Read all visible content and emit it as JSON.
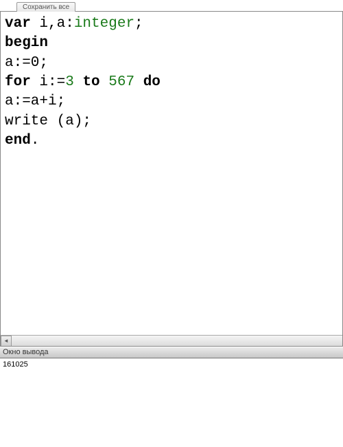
{
  "tab": {
    "label": "Сохранить все"
  },
  "code": {
    "line1": {
      "kw": "var",
      "rest": " i,a:",
      "type": "integer",
      "semi": ";"
    },
    "line2": {
      "kw": "begin"
    },
    "line3": {
      "text": "a:=0;"
    },
    "line4": {
      "kw1": "for",
      "mid1": " i:=",
      "num1": "3",
      "mid2": " ",
      "kw2": "to",
      "mid3": " ",
      "num2": "567",
      "mid4": " ",
      "kw3": "do"
    },
    "line5": {
      "text": "a:=a+i;"
    },
    "line6": {
      "text": "write (a);"
    },
    "line7": {
      "kw": "end",
      "dot": "."
    }
  },
  "output": {
    "header": "Окно вывода",
    "value": "161025"
  },
  "scroll": {
    "left_arrow": "◄"
  }
}
